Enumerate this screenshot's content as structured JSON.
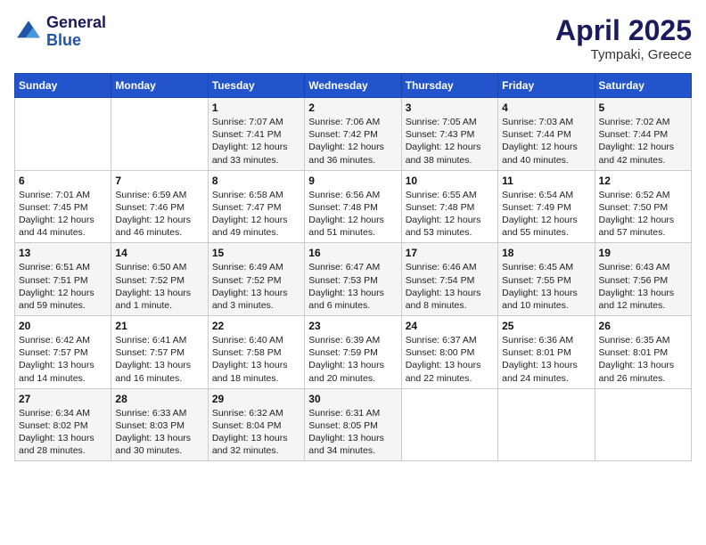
{
  "logo": {
    "line1": "General",
    "line2": "Blue"
  },
  "title": "April 2025",
  "location": "Tympaki, Greece",
  "days_of_week": [
    "Sunday",
    "Monday",
    "Tuesday",
    "Wednesday",
    "Thursday",
    "Friday",
    "Saturday"
  ],
  "weeks": [
    [
      {
        "day": "",
        "content": ""
      },
      {
        "day": "",
        "content": ""
      },
      {
        "day": "1",
        "content": "Sunrise: 7:07 AM\nSunset: 7:41 PM\nDaylight: 12 hours and 33 minutes."
      },
      {
        "day": "2",
        "content": "Sunrise: 7:06 AM\nSunset: 7:42 PM\nDaylight: 12 hours and 36 minutes."
      },
      {
        "day": "3",
        "content": "Sunrise: 7:05 AM\nSunset: 7:43 PM\nDaylight: 12 hours and 38 minutes."
      },
      {
        "day": "4",
        "content": "Sunrise: 7:03 AM\nSunset: 7:44 PM\nDaylight: 12 hours and 40 minutes."
      },
      {
        "day": "5",
        "content": "Sunrise: 7:02 AM\nSunset: 7:44 PM\nDaylight: 12 hours and 42 minutes."
      }
    ],
    [
      {
        "day": "6",
        "content": "Sunrise: 7:01 AM\nSunset: 7:45 PM\nDaylight: 12 hours and 44 minutes."
      },
      {
        "day": "7",
        "content": "Sunrise: 6:59 AM\nSunset: 7:46 PM\nDaylight: 12 hours and 46 minutes."
      },
      {
        "day": "8",
        "content": "Sunrise: 6:58 AM\nSunset: 7:47 PM\nDaylight: 12 hours and 49 minutes."
      },
      {
        "day": "9",
        "content": "Sunrise: 6:56 AM\nSunset: 7:48 PM\nDaylight: 12 hours and 51 minutes."
      },
      {
        "day": "10",
        "content": "Sunrise: 6:55 AM\nSunset: 7:48 PM\nDaylight: 12 hours and 53 minutes."
      },
      {
        "day": "11",
        "content": "Sunrise: 6:54 AM\nSunset: 7:49 PM\nDaylight: 12 hours and 55 minutes."
      },
      {
        "day": "12",
        "content": "Sunrise: 6:52 AM\nSunset: 7:50 PM\nDaylight: 12 hours and 57 minutes."
      }
    ],
    [
      {
        "day": "13",
        "content": "Sunrise: 6:51 AM\nSunset: 7:51 PM\nDaylight: 12 hours and 59 minutes."
      },
      {
        "day": "14",
        "content": "Sunrise: 6:50 AM\nSunset: 7:52 PM\nDaylight: 13 hours and 1 minute."
      },
      {
        "day": "15",
        "content": "Sunrise: 6:49 AM\nSunset: 7:52 PM\nDaylight: 13 hours and 3 minutes."
      },
      {
        "day": "16",
        "content": "Sunrise: 6:47 AM\nSunset: 7:53 PM\nDaylight: 13 hours and 6 minutes."
      },
      {
        "day": "17",
        "content": "Sunrise: 6:46 AM\nSunset: 7:54 PM\nDaylight: 13 hours and 8 minutes."
      },
      {
        "day": "18",
        "content": "Sunrise: 6:45 AM\nSunset: 7:55 PM\nDaylight: 13 hours and 10 minutes."
      },
      {
        "day": "19",
        "content": "Sunrise: 6:43 AM\nSunset: 7:56 PM\nDaylight: 13 hours and 12 minutes."
      }
    ],
    [
      {
        "day": "20",
        "content": "Sunrise: 6:42 AM\nSunset: 7:57 PM\nDaylight: 13 hours and 14 minutes."
      },
      {
        "day": "21",
        "content": "Sunrise: 6:41 AM\nSunset: 7:57 PM\nDaylight: 13 hours and 16 minutes."
      },
      {
        "day": "22",
        "content": "Sunrise: 6:40 AM\nSunset: 7:58 PM\nDaylight: 13 hours and 18 minutes."
      },
      {
        "day": "23",
        "content": "Sunrise: 6:39 AM\nSunset: 7:59 PM\nDaylight: 13 hours and 20 minutes."
      },
      {
        "day": "24",
        "content": "Sunrise: 6:37 AM\nSunset: 8:00 PM\nDaylight: 13 hours and 22 minutes."
      },
      {
        "day": "25",
        "content": "Sunrise: 6:36 AM\nSunset: 8:01 PM\nDaylight: 13 hours and 24 minutes."
      },
      {
        "day": "26",
        "content": "Sunrise: 6:35 AM\nSunset: 8:01 PM\nDaylight: 13 hours and 26 minutes."
      }
    ],
    [
      {
        "day": "27",
        "content": "Sunrise: 6:34 AM\nSunset: 8:02 PM\nDaylight: 13 hours and 28 minutes."
      },
      {
        "day": "28",
        "content": "Sunrise: 6:33 AM\nSunset: 8:03 PM\nDaylight: 13 hours and 30 minutes."
      },
      {
        "day": "29",
        "content": "Sunrise: 6:32 AM\nSunset: 8:04 PM\nDaylight: 13 hours and 32 minutes."
      },
      {
        "day": "30",
        "content": "Sunrise: 6:31 AM\nSunset: 8:05 PM\nDaylight: 13 hours and 34 minutes."
      },
      {
        "day": "",
        "content": ""
      },
      {
        "day": "",
        "content": ""
      },
      {
        "day": "",
        "content": ""
      }
    ]
  ]
}
